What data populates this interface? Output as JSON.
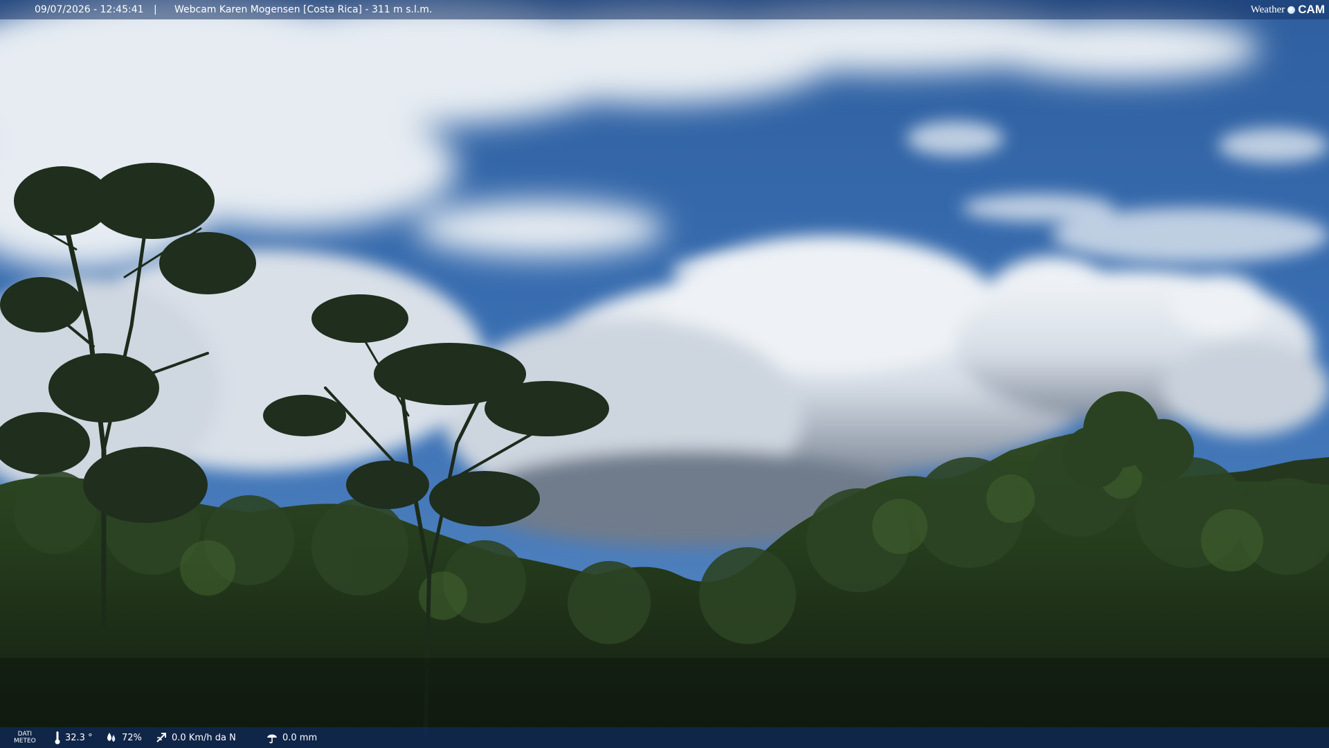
{
  "overlay": {
    "timestamp": "09/07/2026 - 12:45:41",
    "separator": "|",
    "title": "Webcam Karen Mogensen [Costa Rica] - 311 m s.l.m."
  },
  "brand": {
    "weather": "Weather",
    "cam": "CAM"
  },
  "meteo": {
    "label_line1": "DATI",
    "label_line2": "METEO",
    "temperature": "32.3 °",
    "humidity": "72%",
    "wind": "0.0 Km/h da N",
    "rain": "0.0 mm"
  },
  "colors": {
    "sky": "#2e63a8",
    "cloud": "#e9eef3",
    "forest_dark": "#1a2a1a",
    "forest_mid": "#2f4a22",
    "overlay_bar": "#143264"
  }
}
